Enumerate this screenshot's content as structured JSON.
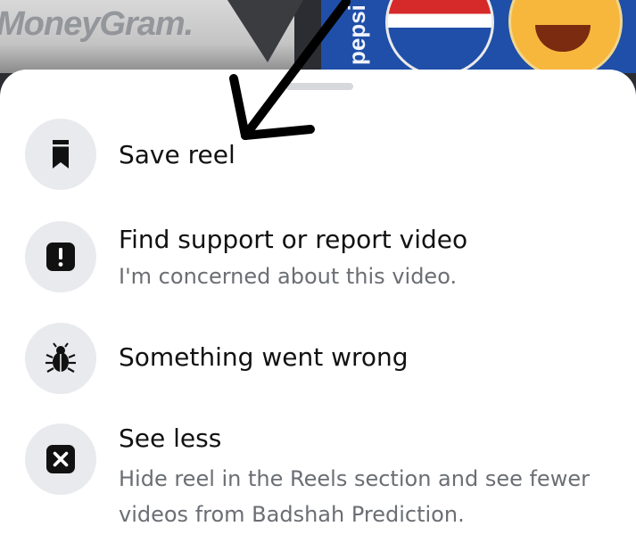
{
  "backdrop": {
    "left_banner_text": "MoneyGram.",
    "right_banner_text": "pepsi"
  },
  "menu": {
    "items": [
      {
        "title": "Save reel",
        "subtitle": "",
        "icon": "bookmark-icon"
      },
      {
        "title": "Find support or report video",
        "subtitle": "I'm concerned about this video.",
        "icon": "report-exclamation-icon"
      },
      {
        "title": "Something went wrong",
        "subtitle": "",
        "icon": "bug-icon"
      },
      {
        "title": "See less",
        "subtitle": "Hide reel in the Reels section and see fewer videos from Badshah Prediction.",
        "icon": "close-box-icon"
      }
    ]
  },
  "colors": {
    "sheet_background": "#ffffff",
    "icon_circle": "#e9eaee",
    "title_text": "#111111",
    "subtitle_text": "#6b6e73",
    "annotation_arrow": "#000000"
  }
}
